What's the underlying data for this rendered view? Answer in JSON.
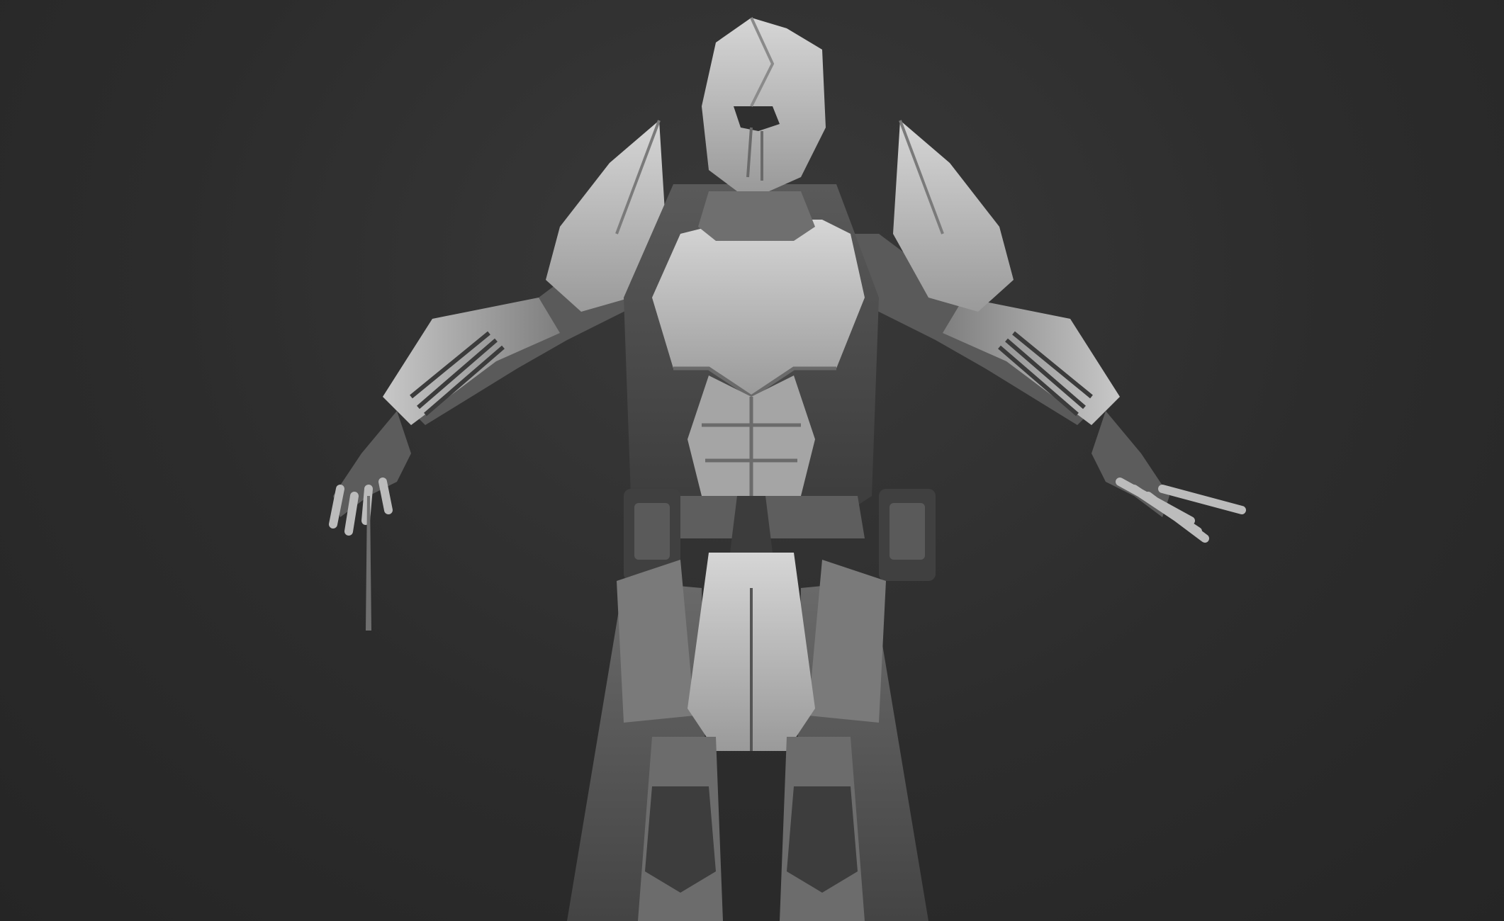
{
  "viewport": {
    "background_color": "#2c2c2c",
    "material_colors": {
      "light": "#bdbdbd",
      "mid": "#8f8f8f",
      "dark": "#4d4d4d",
      "deep": "#333333",
      "highlight": "#e2e2e2"
    }
  },
  "model": {
    "subject": "armored-warrior-sculpt",
    "parts": [
      "helmet",
      "shoulder-pads",
      "chest-plate",
      "abdomen",
      "arms",
      "gauntlets",
      "hands",
      "belt-pouches",
      "tassets",
      "coat-tails",
      "knee-guards",
      "dagger"
    ]
  }
}
